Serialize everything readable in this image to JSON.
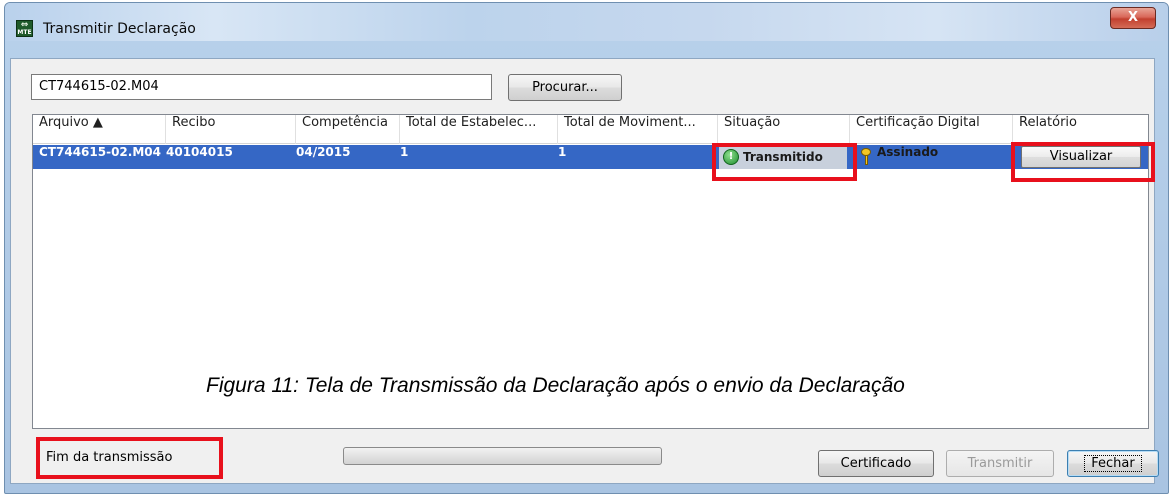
{
  "window": {
    "title": "Transmitir Declaração",
    "app_icon_text": "MTE",
    "close_label": "X"
  },
  "file": {
    "path_value": "CT744615-02.M04",
    "browse_label": "Procurar..."
  },
  "table": {
    "columns": [
      "Arquivo ▲",
      "Recibo",
      "Competência",
      "Total de Estabelec...",
      "Total de Moviment...",
      "Situação",
      "Certificação Digital",
      "Relatório"
    ],
    "rows": [
      {
        "arquivo": "CT744615-02.M04",
        "recibo": "40104015",
        "competencia": "04/2015",
        "total_estabelec": "1",
        "total_moviment": "1",
        "situacao": "Transmitido",
        "certificacao": "Assinado",
        "relatorio_button": "Visualizar"
      }
    ]
  },
  "caption": "Figura 11: Tela de Transmissão da Declaração após o envio da Declaração",
  "footer": {
    "status_text": "Fim da transmissão",
    "progress": 0,
    "certificado_label": "Certificado",
    "transmitir_label": "Transmitir",
    "fechar_label": "Fechar"
  },
  "colors": {
    "selection": "#3567c5",
    "highlight": "#e8101c"
  }
}
